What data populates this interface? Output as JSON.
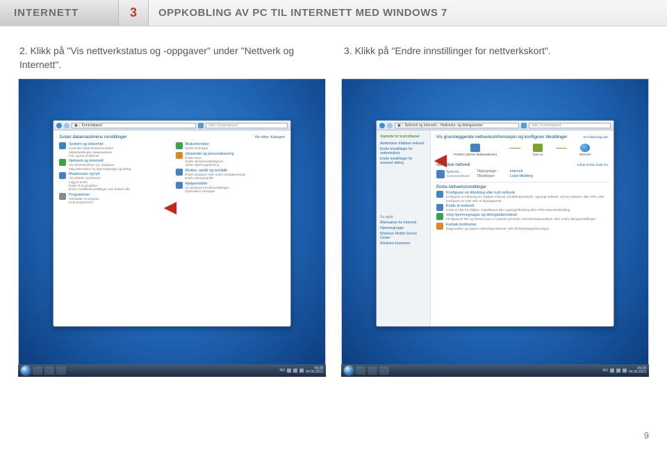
{
  "header": {
    "section": "INTERNETT",
    "chapter_number": "3",
    "title": "OPPKOBLING AV PC TIL INTERNETT MED WINDOWS 7"
  },
  "steps": {
    "s2": {
      "num": "2.",
      "text": "Klikk på \"Vis nettverkstatus og -oppgaver\" under \"Nettverk og Internett\"."
    },
    "s3": {
      "num": "3.",
      "text": "Klikk på \"Endre innstillinger for nettverkskort\"."
    }
  },
  "left_window": {
    "address": "Kontrollpanel",
    "search_placeholder": "Søk i Kontrollpanel",
    "heading": "Juster datamaskinens innstillinger",
    "view_by": "Vis etter: Kategori",
    "groups": [
      {
        "title": "System og sikkerhet",
        "subs": [
          "Kontroller datamaskinens status",
          "Sikkerhetskopier datamaskinen",
          "Finn og løs problemer"
        ]
      },
      {
        "title": "Nettverk og Internett",
        "subs": [
          "Vis nettverksstatus og -oppgaver",
          "Velg alternativer for hjemmegruppe og deling"
        ]
      },
      {
        "title": "Maskinvare og lyd",
        "subs": [
          "Vis enheter og skrivere",
          "Legg til enhet",
          "Koble til en projektor",
          "Endre mobilitetsinnstillinger som brukes ofte"
        ]
      },
      {
        "title": "Programmer",
        "subs": [
          "Avinstaller et program",
          "Hent programmer"
        ]
      }
    ],
    "groups_right": [
      {
        "title": "Brukerkontoer",
        "subs": [
          "Endre kontotype"
        ]
      },
      {
        "title": "Utseende og personalisering",
        "subs": [
          "Endre tema",
          "Endre skrivebordsbakgrunn",
          "Juster skjermoppløsning"
        ]
      },
      {
        "title": "Klokke, språk og område",
        "subs": [
          "Endre tastaturer eller andre inndatametoder",
          "Endre visningsspråk"
        ]
      },
      {
        "title": "Hjelpemiddel",
        "subs": [
          "La Windows foreslå innstillinger",
          "Optimaliser visningen"
        ]
      }
    ],
    "time": "09:28",
    "date": "04.06.2013"
  },
  "right_window": {
    "address_parts": [
      "Nettverk og Internett",
      "Nettverks- og delingssenter"
    ],
    "search_placeholder": "Søk i Kontrollpanel",
    "sidebar_title": "Startside for kontrollpanel",
    "sidebar_items": [
      "Administrer trådløse nettverk",
      "Endre innstillinger for nettverkskort",
      "Endre innstillinger for avansert deling"
    ],
    "see_also_title": "Se også",
    "see_also": [
      "Alternativer for Internett",
      "Hjemmegruppe",
      "Windows Mobile Device Center",
      "Windows-brannmur"
    ],
    "main_heading": "Vis grunnleggende nettverksinformasjon og konfigurer tilkoblinger",
    "full_map": "Se fullstendig kart",
    "nodes": {
      "pc": "PC9261\n(denne datamaskinen)",
      "net": "lyse.no",
      "internet": "Internett"
    },
    "connect_hint": "Koble til eller koble fra",
    "active_title": "Vis aktive nettverk",
    "active_name": "lyse.no",
    "active_type": "Domenenettverk",
    "kv": [
      {
        "k": "Tilgangstype:",
        "v": "Internett"
      },
      {
        "k": "Tilkoblinger:",
        "v": "Lokal tilkobling"
      }
    ],
    "change_title": "Endre nettverksinnstillinger",
    "tasks": [
      {
        "t": "Konfigurer en tilkobling eller nytt nettverk",
        "d": "Konfigurer en tilkobling for trådløst nettverk, bredbåndsnettverk, oppringt nettverk, ad hoc-nettverk, eller VPN, eller konfigurer en ruter eller et tilgangspunkt."
      },
      {
        "t": "Koble til nettverk",
        "d": "Koble til eller fra trådløs-, kabelbasert eller oppringt tilkobling eller VPN-nettverkstilkobling."
      },
      {
        "t": "Velg hjemmegruppe og delingsalternativer",
        "d": "Få tilgang til filer og skrivere som er plassert på andre nettverksdatamaskiner, eller endre delingsinnstillinger."
      },
      {
        "t": "Feilsøk problemer",
        "d": "Diagnostiser og reparer nettverksproblemer, eller få feilsøkingsinformasjon."
      }
    ],
    "time": "09:28",
    "date": "04.06.2013"
  },
  "page_number": "9"
}
